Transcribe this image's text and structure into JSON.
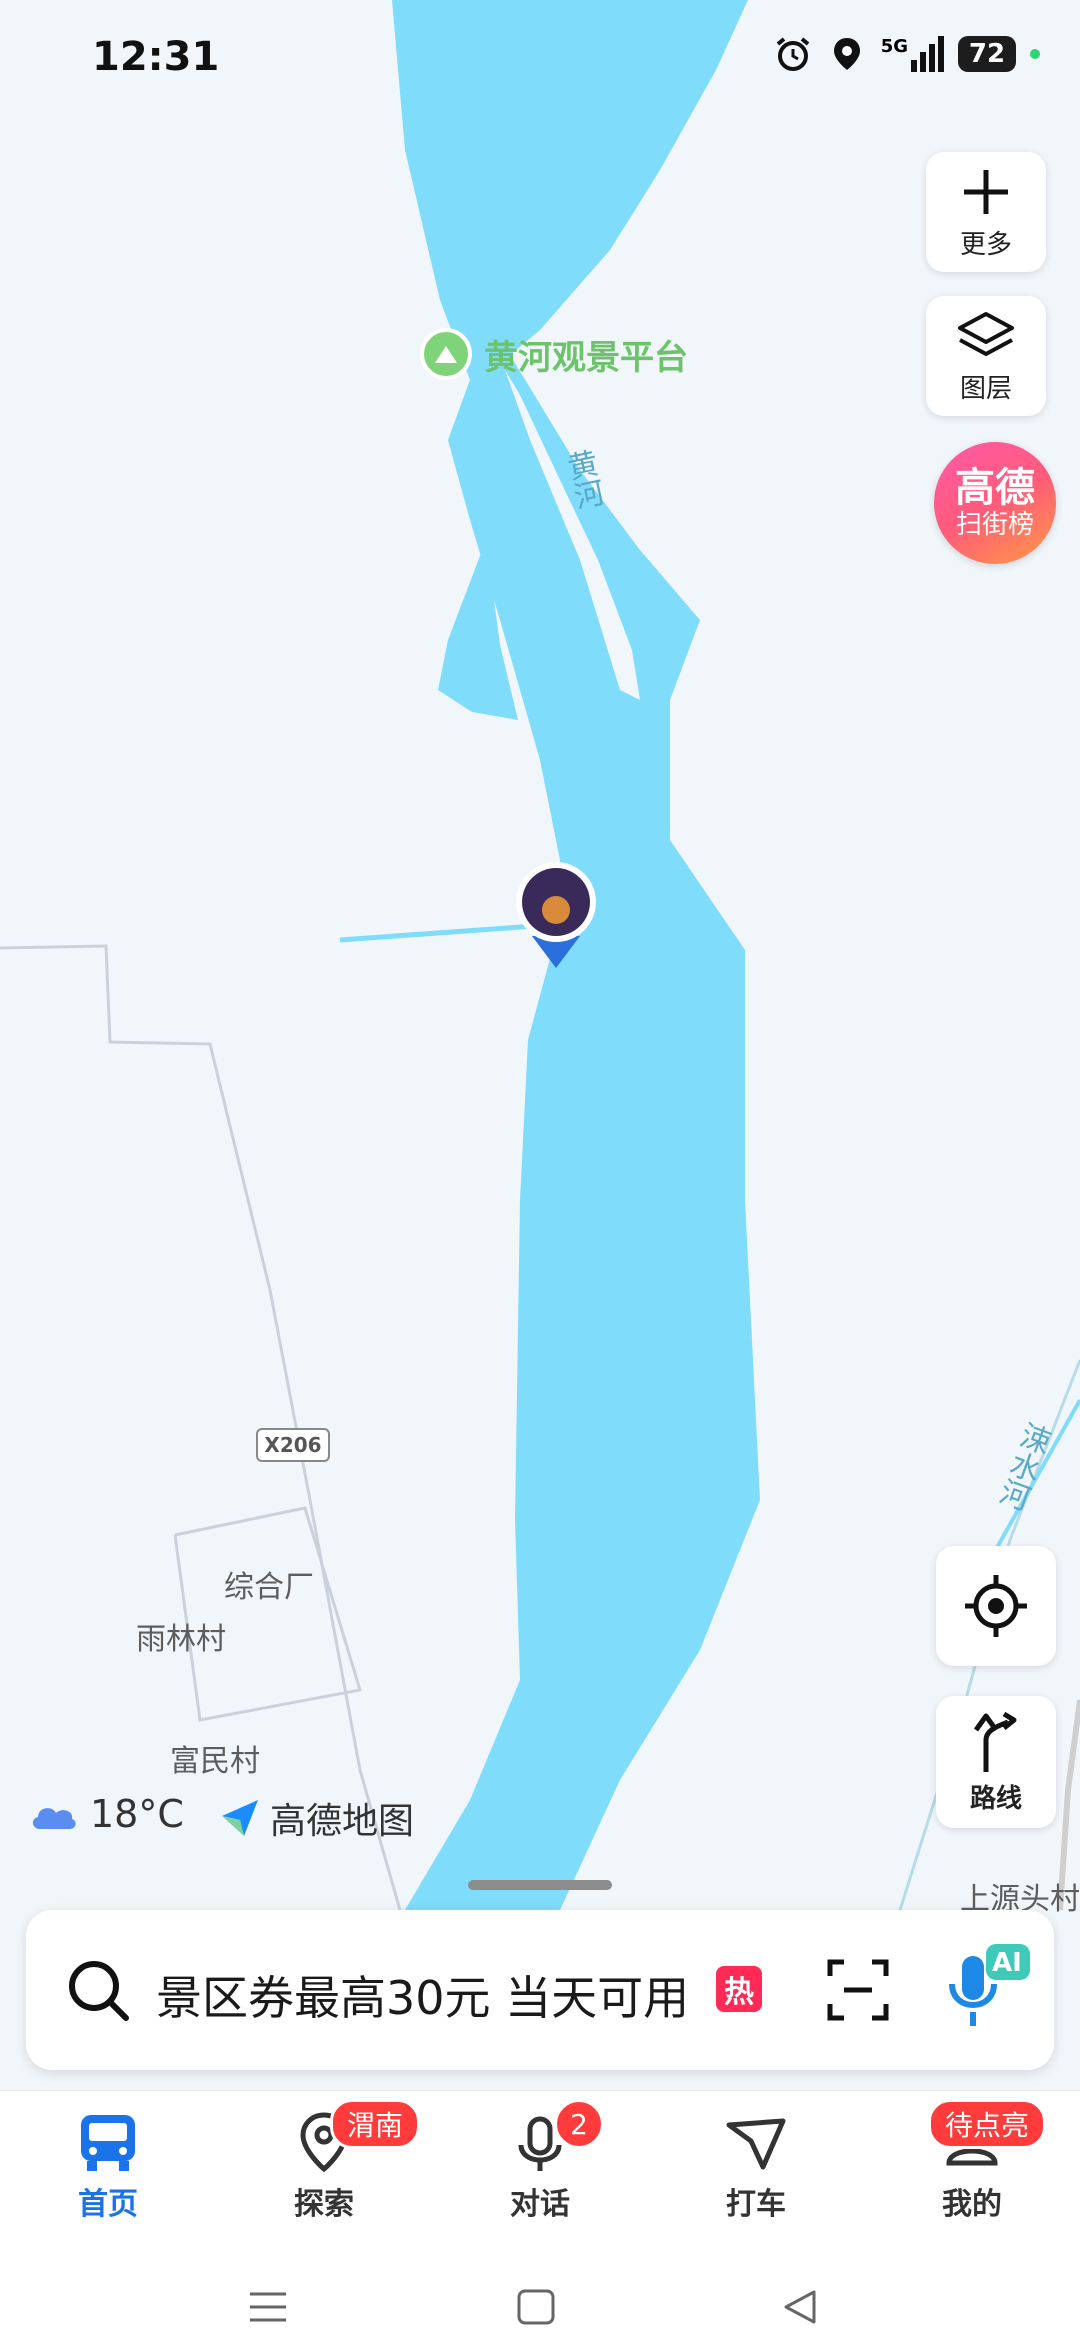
{
  "status_bar": {
    "time": "12:31",
    "network": "5G",
    "battery": "72"
  },
  "map": {
    "poi_scenic": "黄河观景平台",
    "river_main": "黄河",
    "river_side": "涑水河",
    "road_badge": "X206",
    "places": [
      "综合厂",
      "雨林村",
      "富民村",
      "上源头村"
    ]
  },
  "side_buttons": {
    "more_label": "更多",
    "layers_label": "图层",
    "locate_label": "",
    "route_label": "路线"
  },
  "promo": {
    "line1": "高德",
    "line2": "扫街榜"
  },
  "weather": {
    "temperature": "18°C"
  },
  "brand": {
    "name": "高德地图"
  },
  "search": {
    "placeholder": "景区券最高30元 当天可用",
    "hot_badge": "热",
    "ai_label": "AI"
  },
  "tabs": [
    {
      "label": "首页",
      "badge": ""
    },
    {
      "label": "探索",
      "badge": "渭南"
    },
    {
      "label": "对话",
      "badge": "2"
    },
    {
      "label": "打车",
      "badge": ""
    },
    {
      "label": "我的",
      "badge": "待点亮"
    }
  ],
  "colors": {
    "water": "#80dcfb",
    "accent": "#1a73e8",
    "badge": "#ff3b3b",
    "map_bg": "#f1f6fb"
  }
}
